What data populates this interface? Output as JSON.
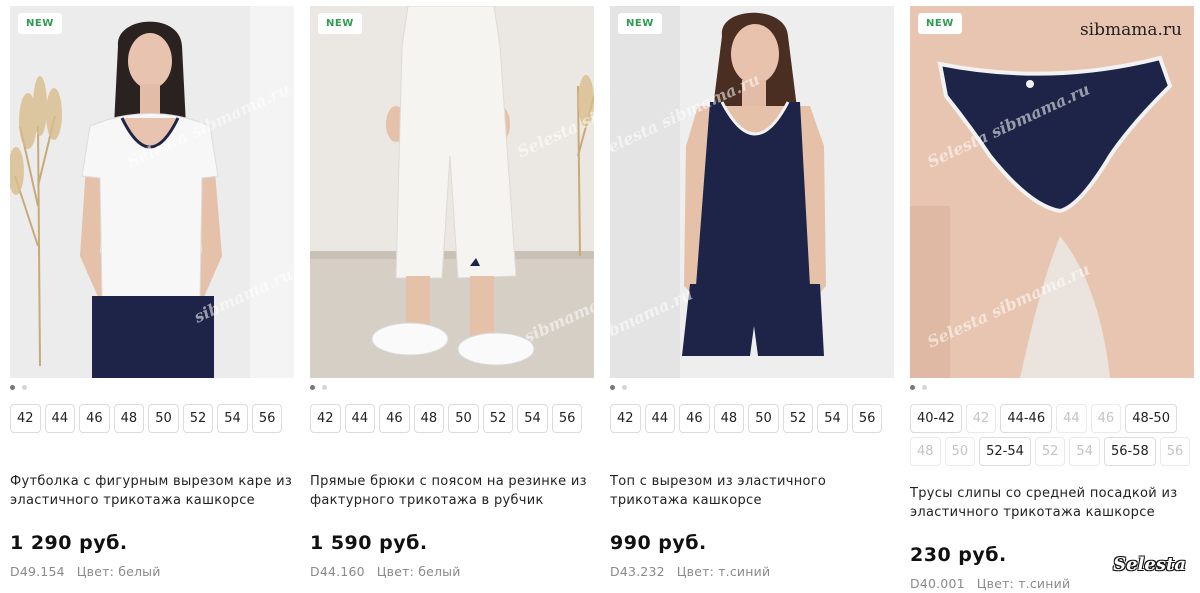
{
  "products": [
    {
      "badge": "NEW",
      "sizes": [
        {
          "label": "42",
          "available": true
        },
        {
          "label": "44",
          "available": true
        },
        {
          "label": "46",
          "available": true
        },
        {
          "label": "48",
          "available": true
        },
        {
          "label": "50",
          "available": true
        },
        {
          "label": "52",
          "available": true
        },
        {
          "label": "54",
          "available": true
        },
        {
          "label": "56",
          "available": true
        }
      ],
      "title": "Футболка с фигурным вырезом каре из эластичного трикотажа кашкорсе",
      "price": "1 290 руб.",
      "sku": "D49.154",
      "color": "Цвет: белый"
    },
    {
      "badge": "NEW",
      "sizes": [
        {
          "label": "42",
          "available": true
        },
        {
          "label": "44",
          "available": true
        },
        {
          "label": "46",
          "available": true
        },
        {
          "label": "48",
          "available": true
        },
        {
          "label": "50",
          "available": true
        },
        {
          "label": "52",
          "available": true
        },
        {
          "label": "54",
          "available": true
        },
        {
          "label": "56",
          "available": true
        }
      ],
      "title": "Прямые брюки с поясом на резинке из фактурного трикотажа в рубчик",
      "price": "1 590 руб.",
      "sku": "D44.160",
      "color": "Цвет: белый"
    },
    {
      "badge": "NEW",
      "sizes": [
        {
          "label": "42",
          "available": true
        },
        {
          "label": "44",
          "available": true
        },
        {
          "label": "46",
          "available": true
        },
        {
          "label": "48",
          "available": true
        },
        {
          "label": "50",
          "available": true
        },
        {
          "label": "52",
          "available": true
        },
        {
          "label": "54",
          "available": true
        },
        {
          "label": "56",
          "available": true
        }
      ],
      "title": "Топ с вырезом из эластичного трикотажа кашкорсе",
      "price": "990 руб.",
      "sku": "D43.232",
      "color": "Цвет: т.синий"
    },
    {
      "badge": "NEW",
      "sizes": [
        {
          "label": "40-42",
          "available": true
        },
        {
          "label": "42",
          "available": false
        },
        {
          "label": "44-46",
          "available": true
        },
        {
          "label": "44",
          "available": false
        },
        {
          "label": "46",
          "available": false
        },
        {
          "label": "48-50",
          "available": true
        },
        {
          "label": "48",
          "available": false
        },
        {
          "label": "50",
          "available": false
        },
        {
          "label": "52-54",
          "available": true
        },
        {
          "label": "52",
          "available": false
        },
        {
          "label": "54",
          "available": false
        },
        {
          "label": "56-58",
          "available": true
        },
        {
          "label": "56",
          "available": false
        }
      ],
      "title": "Трусы слипы со средней посадкой из эластичного трикотажа кашкорсе",
      "price": "230 руб.",
      "sku": "D40.001",
      "color": "Цвет: т.синий"
    }
  ],
  "watermarks": {
    "site": "sibmama.ru",
    "logo": "Selesta",
    "photo_a": "Selesta sibmama.ru",
    "photo_b": "sibmama.ru"
  },
  "colors": {
    "badge_text": "#2f9a52",
    "navy": "#1d2447",
    "white_garment": "#f4f4f2"
  }
}
